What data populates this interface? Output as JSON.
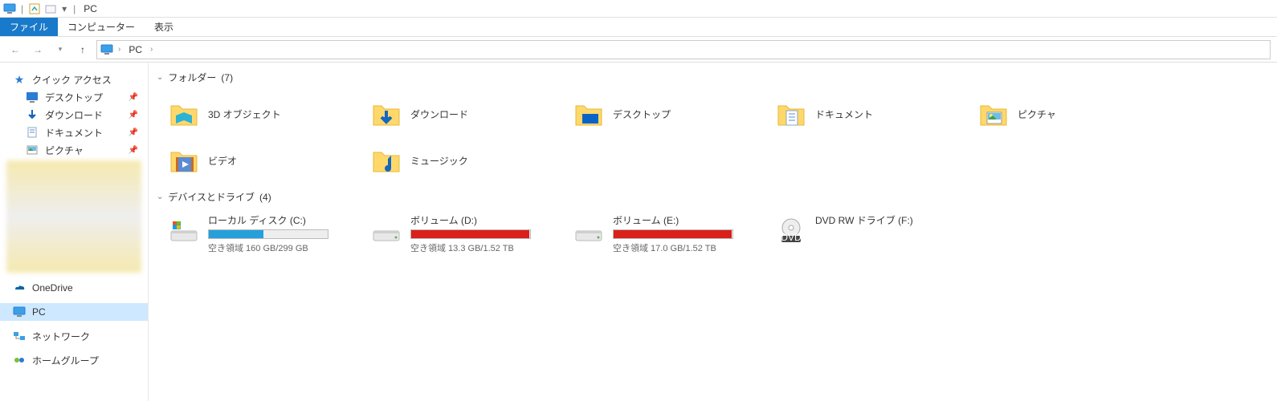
{
  "title": "PC",
  "ribbon": {
    "file": "ファイル",
    "computer": "コンピューター",
    "view": "表示"
  },
  "breadcrumb": {
    "location": "PC"
  },
  "sidebar": {
    "quick_access": "クイック アクセス",
    "pinned": [
      {
        "label": "デスクトップ",
        "icon": "desktop"
      },
      {
        "label": "ダウンロード",
        "icon": "downloads"
      },
      {
        "label": "ドキュメント",
        "icon": "documents"
      },
      {
        "label": "ピクチャ",
        "icon": "pictures"
      }
    ],
    "onedrive": "OneDrive",
    "pc": "PC",
    "network": "ネットワーク",
    "homegroup": "ホームグループ"
  },
  "groups": {
    "folders": {
      "title": "フォルダー",
      "count": 7
    },
    "drives": {
      "title": "デバイスとドライブ",
      "count": 4
    }
  },
  "folders": [
    {
      "label": "3D オブジェクト",
      "icon": "3d"
    },
    {
      "label": "ダウンロード",
      "icon": "downloads"
    },
    {
      "label": "デスクトップ",
      "icon": "desktop"
    },
    {
      "label": "ドキュメント",
      "icon": "documents"
    },
    {
      "label": "ピクチャ",
      "icon": "pictures"
    },
    {
      "label": "ビデオ",
      "icon": "videos"
    },
    {
      "label": "ミュージック",
      "icon": "music"
    }
  ],
  "drives": [
    {
      "label": "ローカル ディスク (C:)",
      "sub": "空き領域 160 GB/299 GB",
      "fill_pct": 46,
      "color": "#26a0da",
      "icon": "osdisk"
    },
    {
      "label": "ボリューム (D:)",
      "sub": "空き領域 13.3 GB/1.52 TB",
      "fill_pct": 99,
      "color": "#d9201a",
      "icon": "hdd"
    },
    {
      "label": "ボリューム (E:)",
      "sub": "空き領域 17.0 GB/1.52 TB",
      "fill_pct": 99,
      "color": "#d9201a",
      "icon": "hdd"
    },
    {
      "label": "DVD RW ドライブ (F:)",
      "sub": "",
      "fill_pct": -1,
      "color": "",
      "icon": "dvd"
    }
  ]
}
